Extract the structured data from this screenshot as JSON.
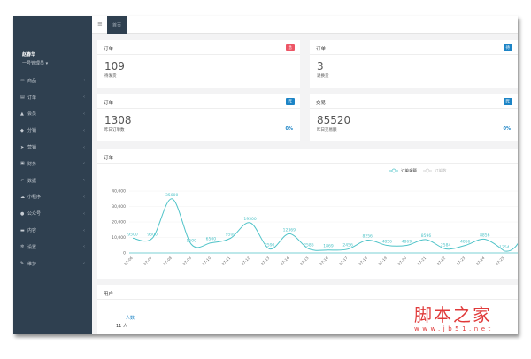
{
  "topbar": {
    "menu_icon": "hamburger-icon",
    "tab": "首页"
  },
  "sidebar": {
    "user_name": "赵春华",
    "user_role": "一号管理员 ▾",
    "items": [
      {
        "label": "商品",
        "icon": "laptop-icon"
      },
      {
        "label": "订单",
        "icon": "list-icon"
      },
      {
        "label": "会员",
        "icon": "user-icon"
      },
      {
        "label": "分销",
        "icon": "users-icon"
      },
      {
        "label": "营销",
        "icon": "send-icon"
      },
      {
        "label": "财务",
        "icon": "money-icon"
      },
      {
        "label": "数据",
        "icon": "chart-icon"
      },
      {
        "label": "小程序",
        "icon": "cloud-icon"
      },
      {
        "label": "公众号",
        "icon": "wechat-icon"
      },
      {
        "label": "内容",
        "icon": "card-icon"
      },
      {
        "label": "设置",
        "icon": "gear-icon"
      },
      {
        "label": "维护",
        "icon": "wrench-icon"
      }
    ]
  },
  "stats": [
    {
      "title": "订单",
      "badge": "急",
      "badge_color": "#ed5565",
      "value": "109",
      "label": "待发货",
      "pct": ""
    },
    {
      "title": "订单",
      "badge": "待",
      "badge_color": "#1c84c6",
      "value": "3",
      "label": "退换货",
      "pct": ""
    },
    {
      "title": "订单",
      "badge": "昨",
      "badge_color": "#1c84c6",
      "value": "1308",
      "label": "昨日订单数",
      "pct": "0%"
    },
    {
      "title": "交易",
      "badge": "昨",
      "badge_color": "#1c84c6",
      "value": "85520",
      "label": "昨日交易额",
      "pct": "0%"
    }
  ],
  "order_chart": {
    "title": "订单"
  },
  "user_chart": {
    "title": "用户",
    "legend": "人数",
    "ytick": "11 人"
  },
  "chart_data": {
    "type": "line",
    "smooth": true,
    "color": "#4fc3c8",
    "legend": [
      "订单金额",
      "订单数"
    ],
    "legend_placement": "top-right",
    "categories": [
      "07-06",
      "07-07",
      "07-08",
      "07-09",
      "07-10",
      "07-11",
      "07-12",
      "07-13",
      "07-14",
      "07-15",
      "07-16",
      "07-17",
      "07-18",
      "07-19",
      "07-20",
      "07-21",
      "07-22",
      "07-23",
      "07-24",
      "07-25"
    ],
    "series": [
      {
        "name": "订单金额",
        "values": [
          9500,
          9500,
          35000,
          5500,
          6500,
          9500,
          19500,
          2590,
          12369,
          2586,
          1869,
          2456,
          8256,
          4856,
          4869,
          8596,
          2584,
          4856,
          8856,
          1254
        ]
      }
    ],
    "yticks": [
      "0",
      "10,000",
      "20,000",
      "30,000",
      "40,000"
    ],
    "ylim": [
      0,
      40000
    ],
    "grid": true
  },
  "watermark": {
    "text": "脚本之家",
    "url": "www.jb51.net"
  }
}
